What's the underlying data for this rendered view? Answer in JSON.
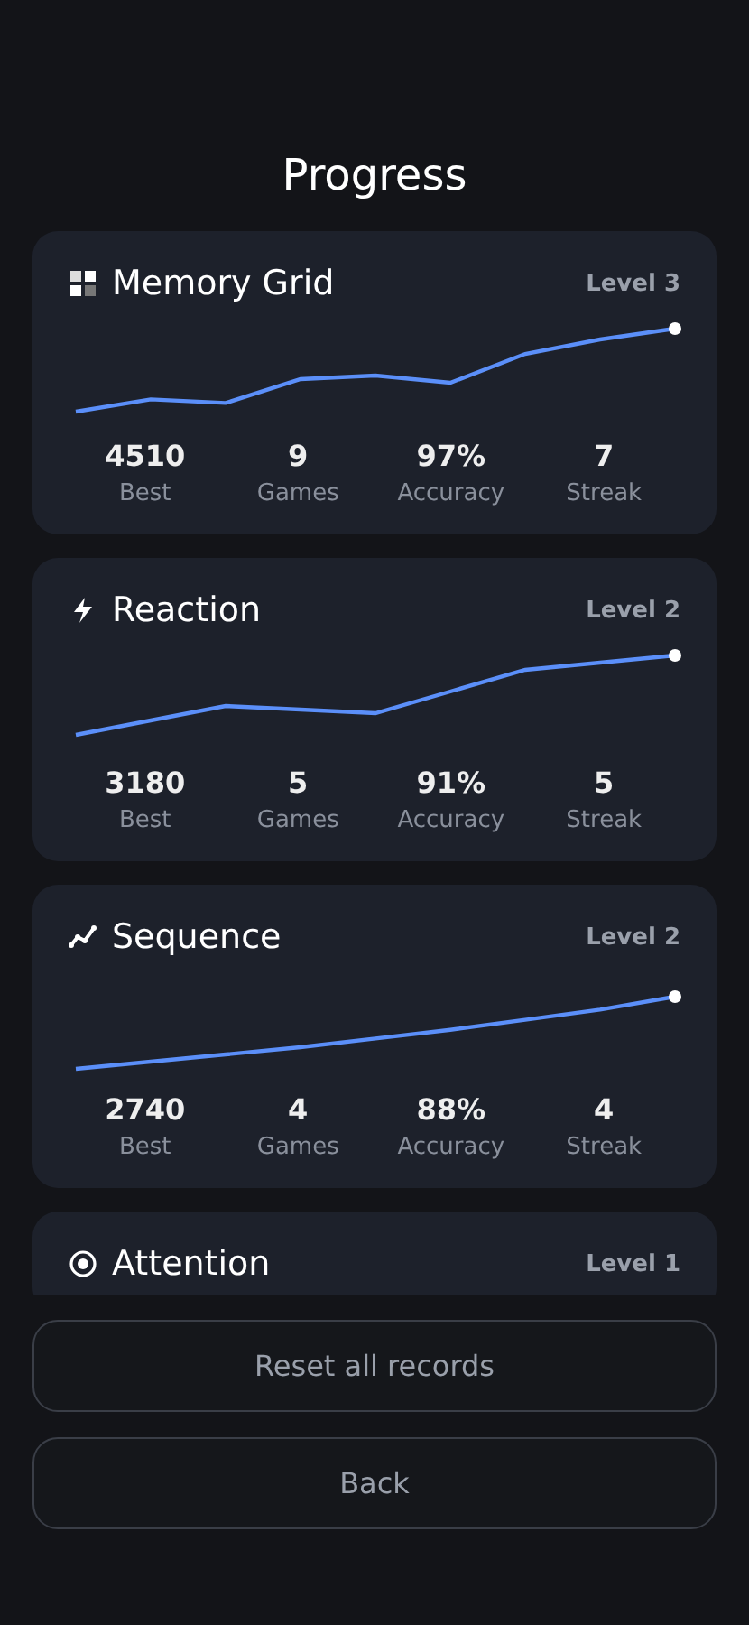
{
  "title": "Progress",
  "games": [
    {
      "kind": "grid",
      "name": "Memory Grid",
      "level": "Level 3",
      "stats": [
        {
          "value": "4510",
          "label": "Best"
        },
        {
          "value": "9",
          "label": "Games"
        },
        {
          "value": "97%",
          "label": "Accuracy"
        },
        {
          "value": "7",
          "label": "Streak"
        }
      ]
    },
    {
      "kind": "bolt",
      "name": "Reaction",
      "level": "Level 2",
      "stats": [
        {
          "value": "3180",
          "label": "Best"
        },
        {
          "value": "5",
          "label": "Games"
        },
        {
          "value": "91%",
          "label": "Accuracy"
        },
        {
          "value": "5",
          "label": "Streak"
        }
      ]
    },
    {
      "kind": "trend",
      "name": "Sequence",
      "level": "Level 2",
      "stats": [
        {
          "value": "2740",
          "label": "Best"
        },
        {
          "value": "4",
          "label": "Games"
        },
        {
          "value": "88%",
          "label": "Accuracy"
        },
        {
          "value": "4",
          "label": "Streak"
        }
      ]
    },
    {
      "kind": "target",
      "name": "Attention",
      "level": "Level 1"
    }
  ],
  "buttons": [
    "Reset all records",
    "Back"
  ]
}
